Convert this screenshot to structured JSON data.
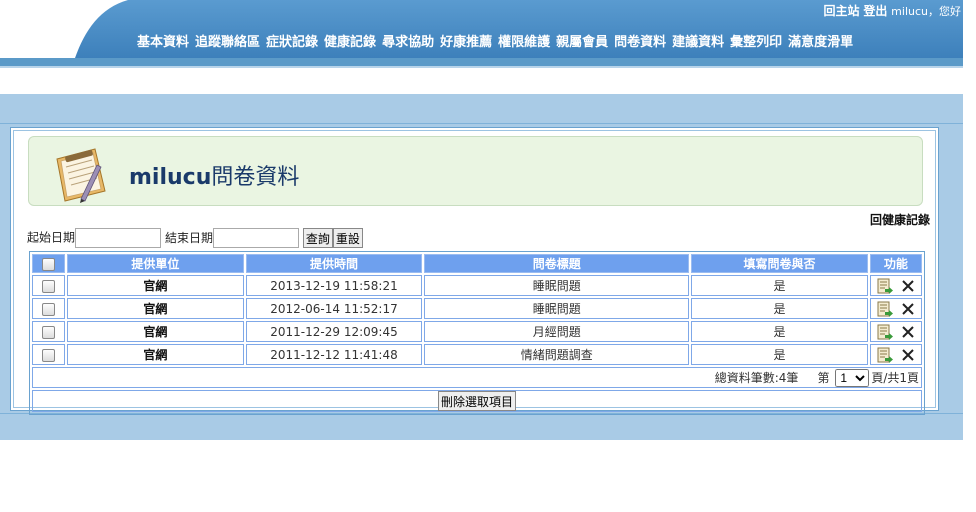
{
  "header": {
    "home_link": "回主站",
    "logout_link": "登出",
    "greeting": "milucu，您好",
    "nav_items": [
      "基本資料",
      "追蹤聯絡區",
      "症狀記錄",
      "健康記錄",
      "尋求協助",
      "好康推薦",
      "權限維護",
      "親屬會員",
      "問卷資料",
      "建議資料",
      "彙整列印",
      "滿意度滑單"
    ]
  },
  "page": {
    "title_user": "milucu",
    "title_text": "問卷資料",
    "back_link": "回健康記錄"
  },
  "filter": {
    "start_label": "起始日期",
    "start_value": "",
    "end_label": "結束日期",
    "end_value": "",
    "query_button": "查詢",
    "reset_button": "重設"
  },
  "table": {
    "headers": [
      "提供單位",
      "提供時間",
      "問卷標題",
      "填寫問卷與否",
      "功能"
    ],
    "rows": [
      {
        "unit": "官網",
        "time": "2013-12-19 11:58:21",
        "title": "睡眠問題",
        "filled": "是"
      },
      {
        "unit": "官網",
        "time": "2012-06-14 11:52:17",
        "title": "睡眠問題",
        "filled": "是"
      },
      {
        "unit": "官網",
        "time": "2011-12-29 12:09:45",
        "title": "月經問題",
        "filled": "是"
      },
      {
        "unit": "官網",
        "time": "2011-12-12 11:41:48",
        "title": "情緒問題調查",
        "filled": "是"
      }
    ]
  },
  "pager": {
    "total_text": "總資料筆數:4筆",
    "page_prefix": "第",
    "current_page": "1",
    "page_suffix": "頁/共1頁"
  },
  "actions": {
    "delete_selected": "刪除選取項目"
  },
  "colors": {
    "header_blue": "#4f8fc2",
    "band": "#a9cbe6",
    "table_header": "#6ea0ee",
    "title_box": "#eaf5e2"
  },
  "icons": {
    "edit": "edit-document-icon",
    "delete": "close-x-icon",
    "title": "notepad-pen-icon"
  }
}
